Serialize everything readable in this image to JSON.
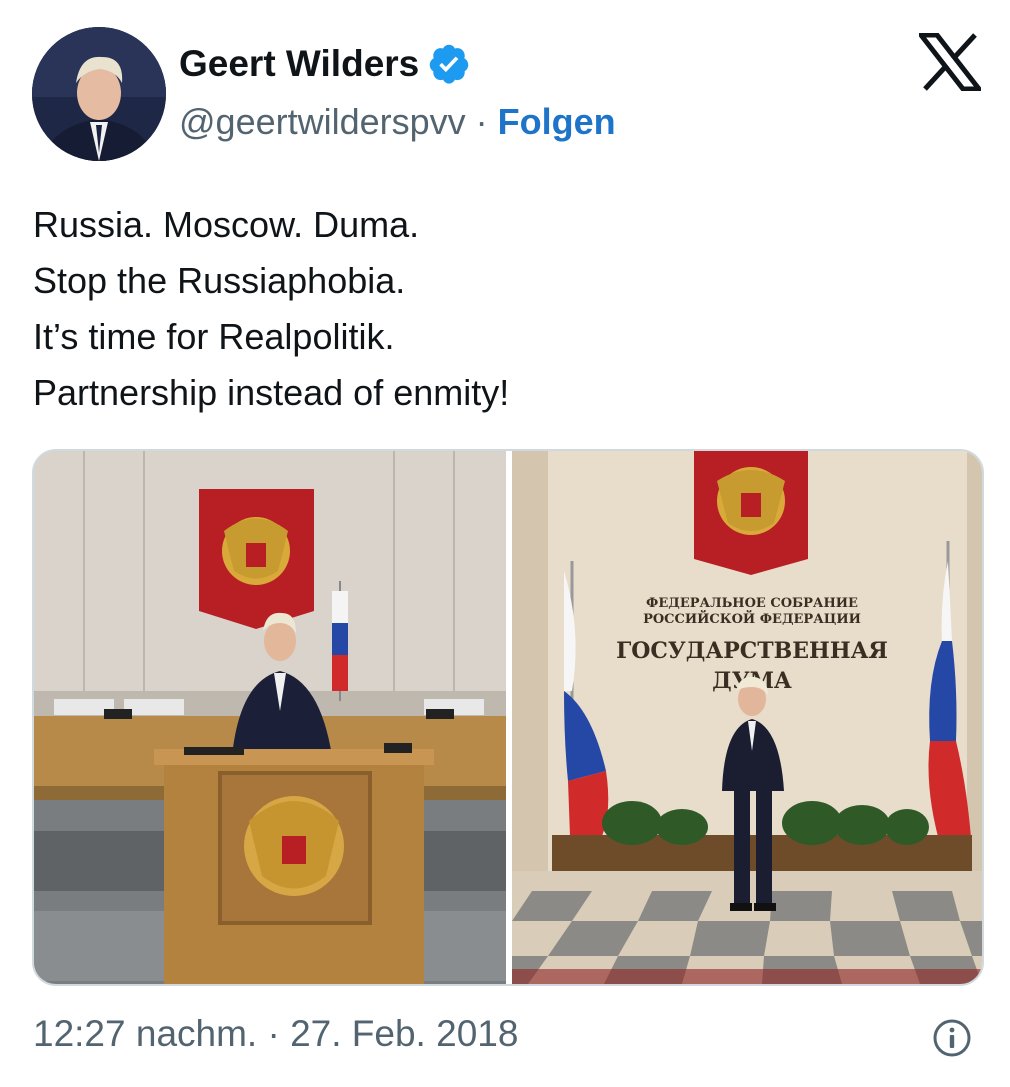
{
  "author": {
    "name": "Geert Wilders",
    "handle": "@geertwilderspvv",
    "separator": "·",
    "follow_label": "Folgen",
    "verified": true,
    "verified_color": "#1d9bf0"
  },
  "brand": {
    "logo": "x-logo-icon"
  },
  "tweet": {
    "lines": [
      "Russia. Moscow. Duma.",
      "Stop the Russiaphobia.",
      "It’s time for Realpolitik.",
      "Partnership instead of enmity!"
    ]
  },
  "media": {
    "photo2_sign": {
      "line1": "ФЕДЕРАЛЬНОЕ СОБРАНИЕ",
      "line2": "РОССИЙСКОЙ ФЕДЕРАЦИИ",
      "line3": "ГОСУДАРСТВЕННАЯ",
      "line4": "ДУМА"
    }
  },
  "footer": {
    "timestamp": "12:27 nachm. · 27. Feb. 2018",
    "info_icon": "info-icon"
  },
  "colors": {
    "link": "#1d74c9",
    "secondary_text": "#536471",
    "border": "#cfd9de"
  }
}
